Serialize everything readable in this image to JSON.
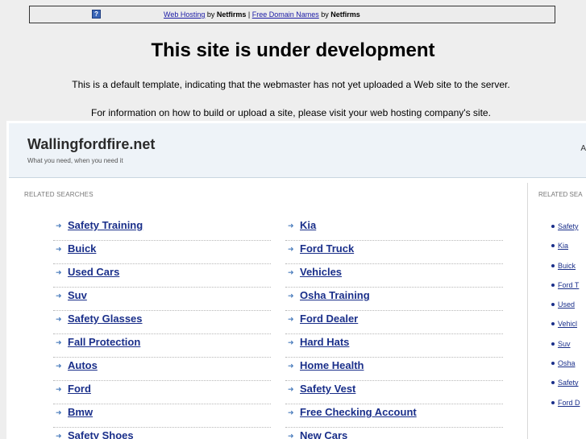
{
  "banner": {
    "icon": "question-icon",
    "icon_glyph": "?",
    "link1": "Web Hosting",
    "by1": " by ",
    "brand1": "Netfirms",
    "sep": " | ",
    "link2": "Free Domain Names",
    "by2": " by ",
    "brand2": "Netfirms"
  },
  "headline": "This site is under development",
  "paragraph1": "This is a default template, indicating that the webmaster has not yet uploaded a Web site to the server.",
  "paragraph2": "For information on how to build or upload a site, please visit your web hosting company's site.",
  "parked": {
    "domain": "Wallingfordfire.net",
    "tagline": "What you need, when you need it",
    "header_right": "A",
    "related_heading": "RELATED SEARCHES",
    "left_terms": [
      "Safety Training",
      "Buick",
      "Used Cars",
      "Suv",
      "Safety Glasses",
      "Fall Protection",
      "Autos",
      "Ford",
      "Bmw",
      "Safety Shoes"
    ],
    "right_terms": [
      "Kia",
      "Ford Truck",
      "Vehicles",
      "Osha Training",
      "Ford Dealer",
      "Hard Hats",
      "Home Health",
      "Safety Vest",
      "Free Checking Account",
      "New Cars"
    ],
    "side_heading": "RELATED SEA",
    "side_terms": [
      "Safety",
      "Kia",
      "Buick",
      "Ford T",
      "Used",
      "Vehicl",
      "Suv",
      "Osha",
      "Safety",
      "Ford D"
    ]
  },
  "colors": {
    "link": "#1a2f8a",
    "arrow": "#4b7dbd",
    "header_bg": "#eef3f8",
    "page_bg": "#eeeeee"
  }
}
